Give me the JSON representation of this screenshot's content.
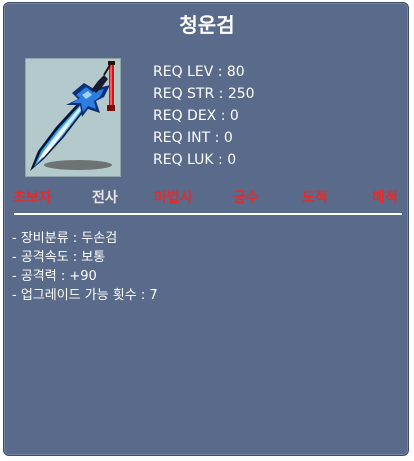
{
  "item": {
    "name": "청운검",
    "icon": "blue-two-handed-sword-icon"
  },
  "requirements": [
    "REQ LEV : 80",
    "REQ STR : 250",
    "REQ DEX : 0",
    "REQ INT : 0",
    "REQ LUK : 0"
  ],
  "jobs": [
    {
      "label": "초보자",
      "allowed": false
    },
    {
      "label": "전사",
      "allowed": true
    },
    {
      "label": "마법사",
      "allowed": false
    },
    {
      "label": "궁수",
      "allowed": false
    },
    {
      "label": "도적",
      "allowed": false
    },
    {
      "label": "해적",
      "allowed": false
    }
  ],
  "stats": [
    "- 장비분류 : 두손검",
    "- 공격속도 : 보통",
    "- 공격력 : +90",
    "- 업그레이드 가능 횟수 : 7"
  ],
  "colors": {
    "panel": "#5a6a8a",
    "allowed_job": "#e8e8e8",
    "restricted_job": "#e52b2b"
  }
}
